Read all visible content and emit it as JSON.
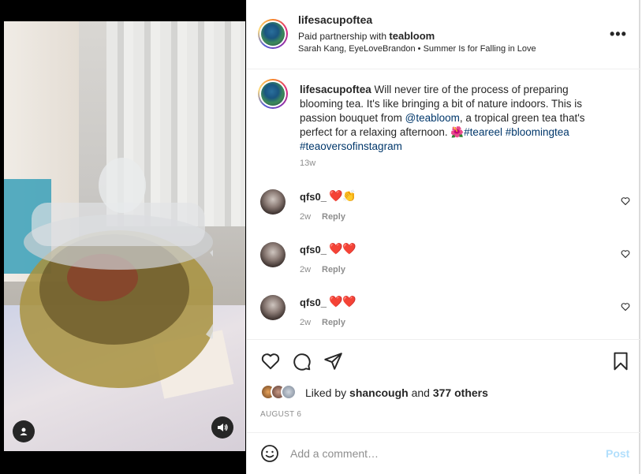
{
  "post": {
    "username": "lifesacupoftea",
    "partnership_prefix": "Paid partnership with",
    "partner": "teabloom",
    "audio": "Sarah Kang, EyeLoveBrandon • Summer Is for Falling in Love",
    "more_icon": "•••"
  },
  "caption": {
    "username": "lifesacupoftea",
    "text_1": "Will never tire of the process of preparing blooming tea. It's like bringing a bit of nature indoors. This is passion bouquet from",
    "mention": "@teabloom",
    "text_2": ", a tropical green tea that's perfect for a relaxing afternoon. 🌺",
    "hashtags": [
      "#teareel",
      "#bloomingtea",
      "#teaoversofinstagram"
    ],
    "time": "13w"
  },
  "comments": [
    {
      "username": "qfs0_",
      "text": "❤️👏",
      "time": "2w",
      "reply": "Reply"
    },
    {
      "username": "qfs0_",
      "text": "❤️❤️",
      "time": "2w",
      "reply": "Reply"
    },
    {
      "username": "qfs0_",
      "text": "❤️❤️",
      "time": "2w",
      "reply": "Reply"
    }
  ],
  "likes": {
    "prefix": "Liked by",
    "user": "shancough",
    "connector": "and",
    "others": "377 others"
  },
  "date": "AUGUST 6",
  "add_comment": {
    "placeholder": "Add a comment…",
    "post_label": "Post"
  },
  "icons": {
    "like": "heart-icon",
    "comment": "comment-icon",
    "share": "paper-plane-icon",
    "save": "bookmark-icon",
    "emoji": "smiley-icon",
    "user_tag": "person-icon",
    "audio": "speaker-icon"
  },
  "colors": {
    "link": "#00376b",
    "muted": "#8e8e8e",
    "post_disabled": "#b2dffc"
  }
}
